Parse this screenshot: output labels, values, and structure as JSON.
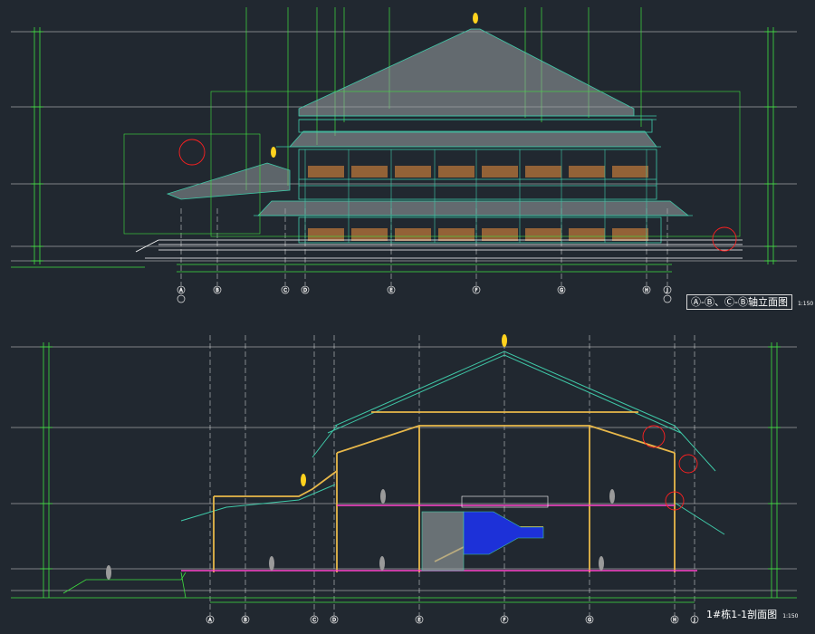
{
  "colors": {
    "background": "#212830",
    "axis_line": "#e8e8e8",
    "dimension": "#3fe03f",
    "roof": "#3fc9a8",
    "roof_tiles": "#9aa1a4",
    "beam": "#e8b84a",
    "floor_slab": "#ff44cc",
    "stair_fill": "#1d31d8",
    "railing": "#ffffff",
    "window": "#b0703a",
    "revision_cloud": "#ff2020",
    "finial": "#ffd21e",
    "leader_text": "#ffffff",
    "figure": "#9a9a9a"
  },
  "elevation": {
    "caption": "Ⓐ-Ⓑ、Ⓒ-Ⓑ轴立面图",
    "scale": "1:150",
    "grid_axes": [
      "A",
      "B",
      "C",
      "D",
      "E",
      "F",
      "G",
      "H",
      "J"
    ]
  },
  "section": {
    "caption": "1#栋1-1剖面图",
    "scale": "1:150",
    "grid_axes": [
      "A",
      "B",
      "C",
      "D",
      "E",
      "F",
      "G",
      "H",
      "J"
    ]
  }
}
